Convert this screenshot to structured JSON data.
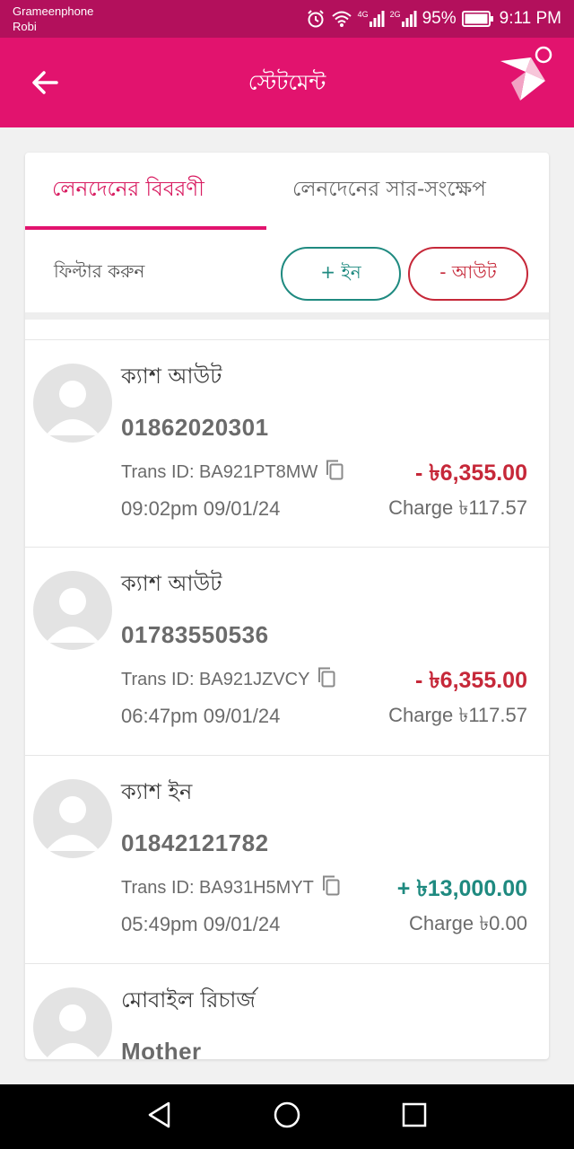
{
  "status_bar": {
    "carrier1": "Grameenphone",
    "carrier2": "Robi",
    "net1": "4G",
    "net2": "2G",
    "battery": "95%",
    "time": "9:11 PM"
  },
  "app_bar": {
    "title": "স্টেটমেন্ট"
  },
  "tabs": [
    {
      "label": "লেনদেনের বিবরণী",
      "active": true
    },
    {
      "label": "লেনদেনের সার-সংক্ষেপ",
      "active": false
    }
  ],
  "filter": {
    "label": "ফিল্টার করুন",
    "in_label": "+  ইন",
    "out_label": "-  আউট"
  },
  "transactions": [
    {
      "type": "ক্যাশ আউট",
      "number": "01862020301",
      "trans_id": "Trans ID: BA921PT8MW",
      "time": "09:02pm 09/01/24",
      "amount": "- ৳6,355.00",
      "charge": "Charge ৳117.57",
      "direction": "out"
    },
    {
      "type": "ক্যাশ আউট",
      "number": "01783550536",
      "trans_id": "Trans ID: BA921JZVCY",
      "time": "06:47pm 09/01/24",
      "amount": "- ৳6,355.00",
      "charge": "Charge ৳117.57",
      "direction": "out"
    },
    {
      "type": "ক্যাশ ইন",
      "number": "01842121782",
      "trans_id": "Trans ID: BA931H5MYT",
      "time": "05:49pm 09/01/24",
      "amount": "+ ৳13,000.00",
      "charge": "Charge ৳0.00",
      "direction": "in"
    },
    {
      "type": "মোবাইল রিচার্জ",
      "number": "Mother",
      "trans_id": "",
      "time": "",
      "amount": "",
      "charge": "",
      "direction": "out"
    }
  ],
  "colors": {
    "brand": "#e2136e",
    "status_bar": "#b3105c",
    "in": "#1f8a80",
    "out": "#c62839"
  },
  "icons": [
    "back-arrow-icon",
    "bkash-logo-icon",
    "copy-icon",
    "alarm-icon",
    "wifi-icon",
    "signal-icon",
    "battery-icon",
    "nav-back-icon",
    "nav-home-icon",
    "nav-recents-icon"
  ]
}
